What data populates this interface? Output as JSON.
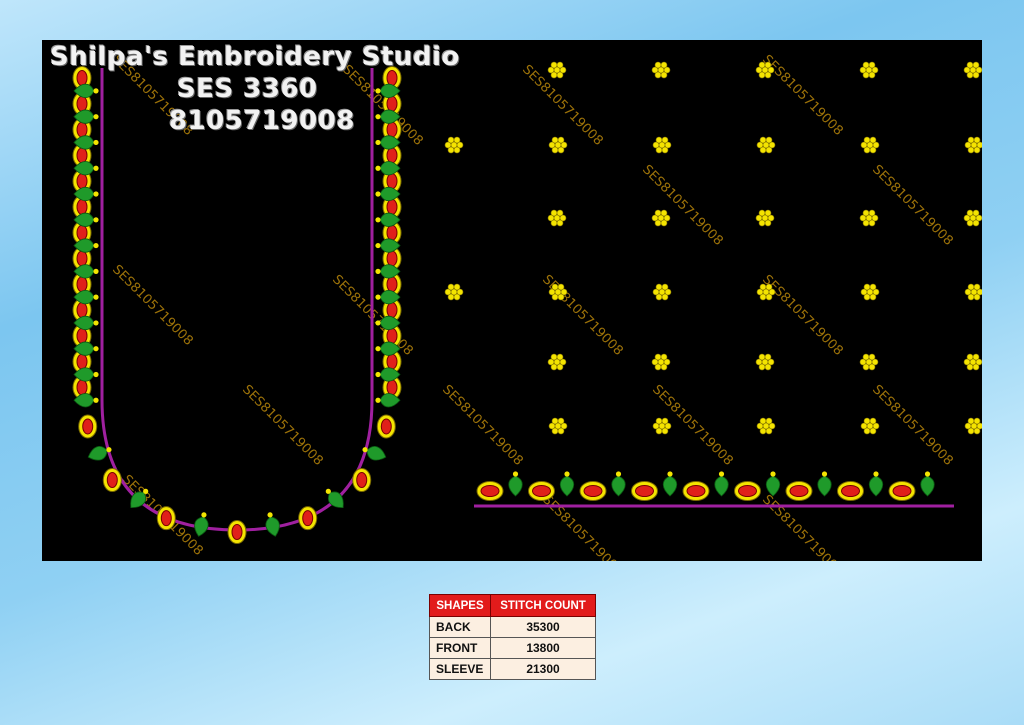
{
  "studio": {
    "name": "Shilpa's Embroidery Studio",
    "design_code": "SES  3360",
    "phone": "8105719008"
  },
  "watermark": "SES8105719008",
  "colors": {
    "background": "#000000",
    "stone_red": "#e0201a",
    "gold": "#f4e400",
    "leaf_green": "#1f9a2a",
    "border_purple": "#a020a0",
    "header_red": "#e21b1b",
    "cell_bg": "#fcefe1"
  },
  "table": {
    "headers": [
      "SHAPES",
      "STITCH COUNT"
    ],
    "rows": [
      {
        "shape": "BACK",
        "count": "35300"
      },
      {
        "shape": "FRONT",
        "count": "13800"
      },
      {
        "shape": "SLEEVE",
        "count": "21300"
      }
    ]
  }
}
